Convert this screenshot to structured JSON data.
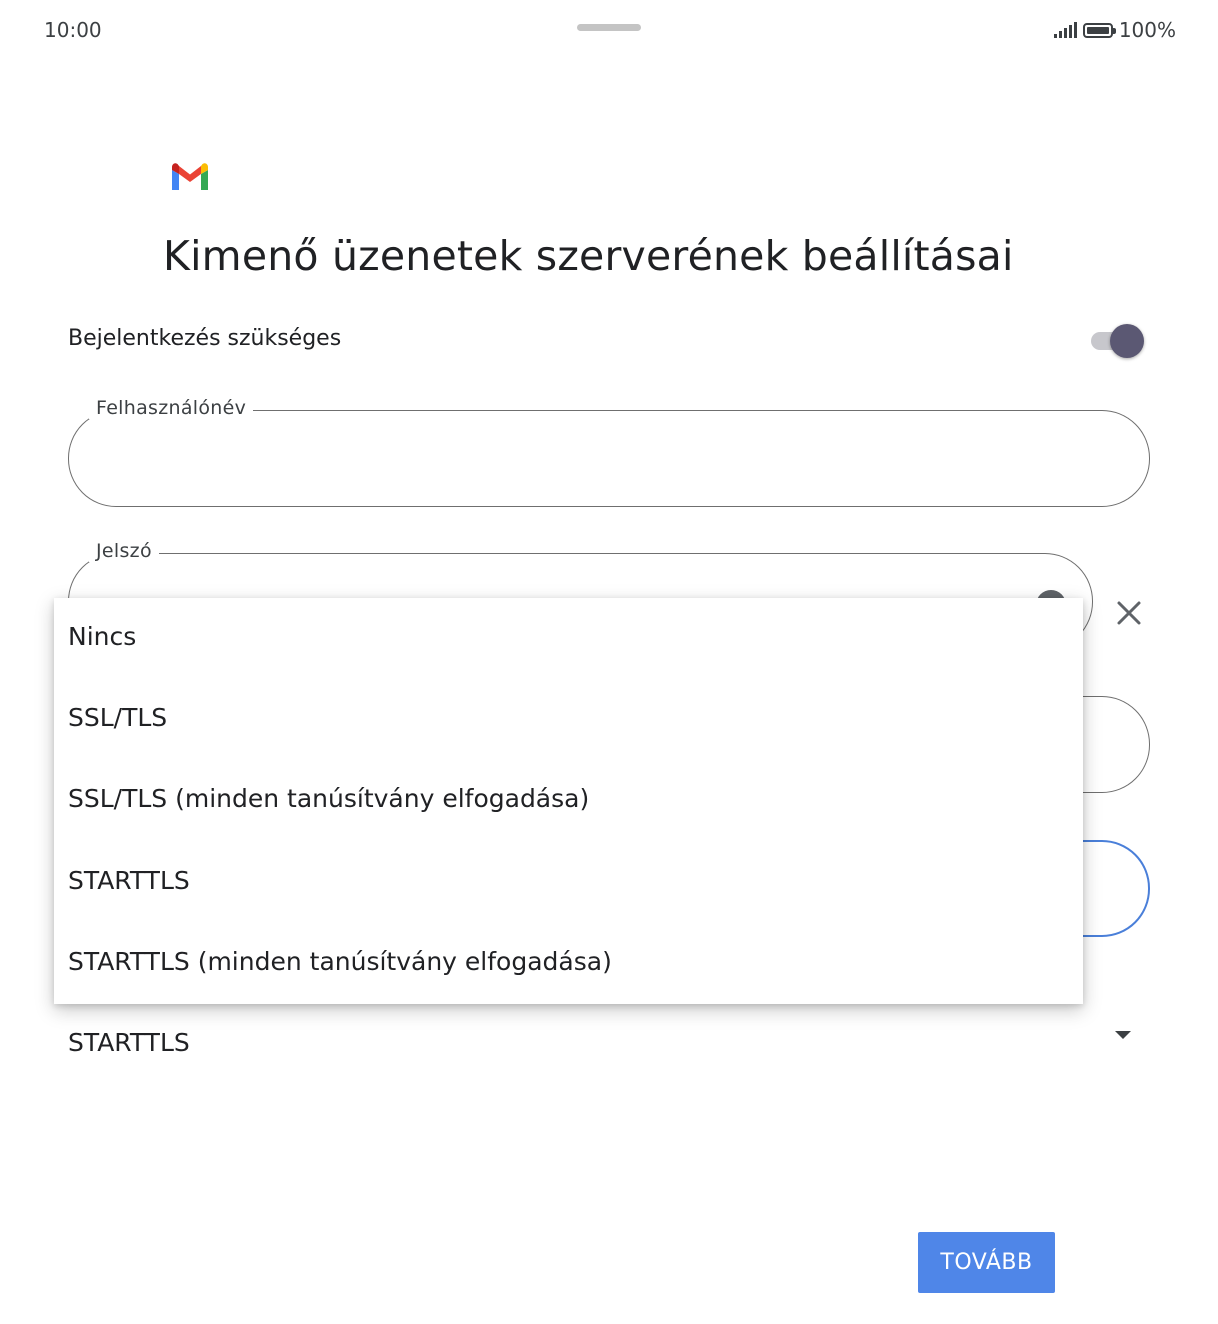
{
  "status_bar": {
    "time": "10:00",
    "battery": "100%",
    "icons": [
      "signal-icon",
      "battery-icon"
    ]
  },
  "logo": {
    "icon": "gmail-logo"
  },
  "title": "Kimenő üzenetek szerverének beállításai",
  "login_required": {
    "label": "Bejelentkezés szükséges",
    "enabled": true
  },
  "username": {
    "label": "Felhasználónév",
    "value": ""
  },
  "password": {
    "label": "Jelszó",
    "value": ""
  },
  "server": {
    "value": ""
  },
  "port": {
    "value": ""
  },
  "security": {
    "selected": "STARTTLS",
    "options": [
      "Nincs",
      "SSL/TLS",
      "SSL/TLS (minden tanúsítvány elfogadása)",
      "STARTTLS",
      "STARTTLS (minden tanúsítvány elfogadása)"
    ]
  },
  "next_button": "TOVÁBB",
  "colors": {
    "accent": "#4f86e8",
    "focused_outline": "#4a7fd9",
    "toggle_thumb": "#5b5873"
  }
}
